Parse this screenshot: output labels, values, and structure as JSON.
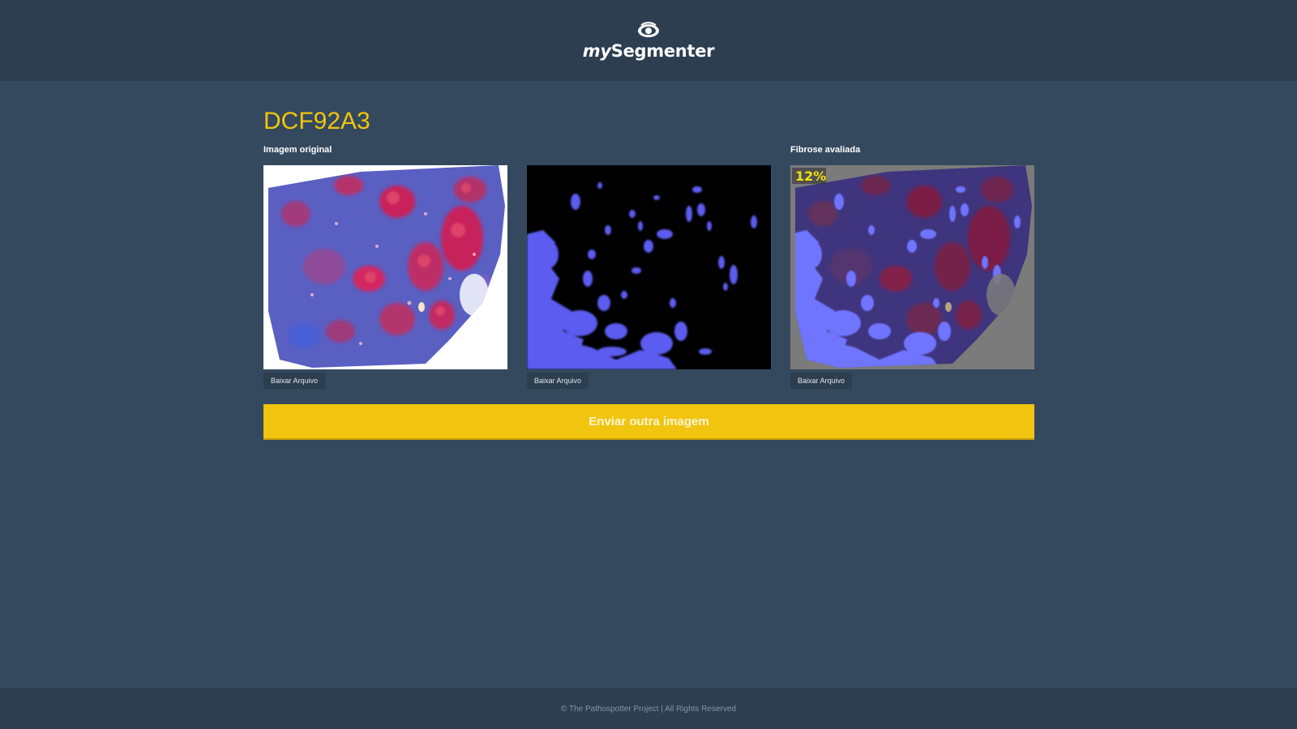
{
  "header": {
    "logo_icon": "eye-icon",
    "logo_prefix": "my",
    "logo_suffix": "Segmenter"
  },
  "main": {
    "sample_id": "DCF92A3",
    "panels": [
      {
        "label": "Imagem original",
        "download_label": "Baixar Arquivo",
        "image": "stained-tissue-image"
      },
      {
        "label": "",
        "download_label": "Baixar Arquivo",
        "image": "fibrosis-mask-image"
      },
      {
        "label": "Fibrose avaliada",
        "download_label": "Baixar Arquivo",
        "image": "fibrosis-overlay-image",
        "badge": "12%"
      }
    ],
    "send_button_label": "Enviar outra imagem"
  },
  "footer": {
    "text": "© The Pathospotter Project | All Rights Reserved"
  },
  "colors": {
    "page_bg": "#34495e",
    "bar_bg": "#2c3e50",
    "accent": "#f1c40f"
  }
}
